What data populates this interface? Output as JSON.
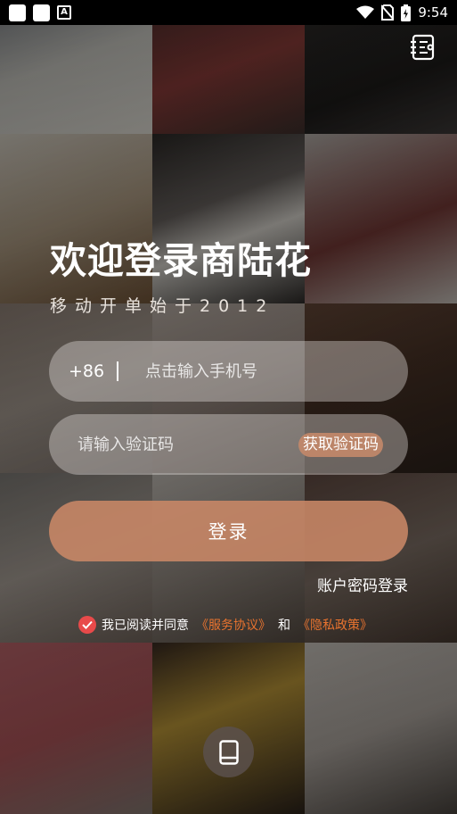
{
  "status_bar": {
    "time": "9:54",
    "icons": [
      "app-square-icon",
      "app-square-icon",
      "font-a-icon",
      "wifi-icon",
      "no-sim-icon",
      "battery-charging-icon"
    ],
    "a_glyph": "A"
  },
  "header": {
    "top_right_icon": "guide-list-icon"
  },
  "hero": {
    "title": "欢迎登录商陆花",
    "subtitle": "移动开单始于2012"
  },
  "phone": {
    "prefix": "+86",
    "placeholder": "点击输入手机号",
    "value": ""
  },
  "code": {
    "placeholder": "请输入验证码",
    "value": "",
    "get_code_label": "获取验证码"
  },
  "login_label": "登录",
  "password_login_label": "账户密码登录",
  "agreement": {
    "checked": true,
    "prefix_text": "我已阅读并同意",
    "service_link": "《服务协议》",
    "and_text": "和",
    "privacy_link": "《隐私政策》"
  },
  "bottom_icon": "tablet-icon",
  "colors": {
    "accent": "#c98867",
    "link": "#e8732f",
    "check": "#e84a4a"
  }
}
